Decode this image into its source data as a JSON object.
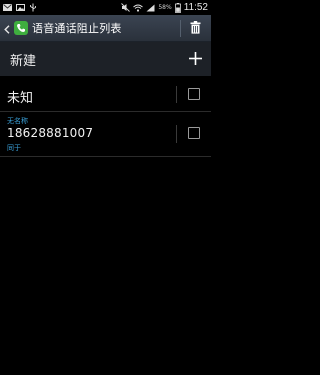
{
  "status_bar": {
    "battery_percent": "58%",
    "time": "11:52"
  },
  "action_bar": {
    "title": "语音通话阻止列表"
  },
  "new_row": {
    "label": "新建"
  },
  "list": {
    "unknown_label": "未知",
    "entry": {
      "name": "无名称",
      "number": "18628881007",
      "match": "同于"
    }
  },
  "colors": {
    "accent_blue": "#3aa0d8",
    "action_bar": "#2f3742",
    "new_row_bg": "#1d2127",
    "app_icon_green": "#3fae3f"
  },
  "icons": {
    "status_left": [
      "envelope-icon",
      "image-icon",
      "usb-icon"
    ],
    "status_right": [
      "mute-icon",
      "wifi-icon",
      "signal-icon",
      "battery-icon"
    ],
    "action_bar": [
      "back-chevron-icon",
      "phone-app-icon",
      "trash-icon"
    ],
    "new_row": [
      "plus-icon"
    ]
  }
}
